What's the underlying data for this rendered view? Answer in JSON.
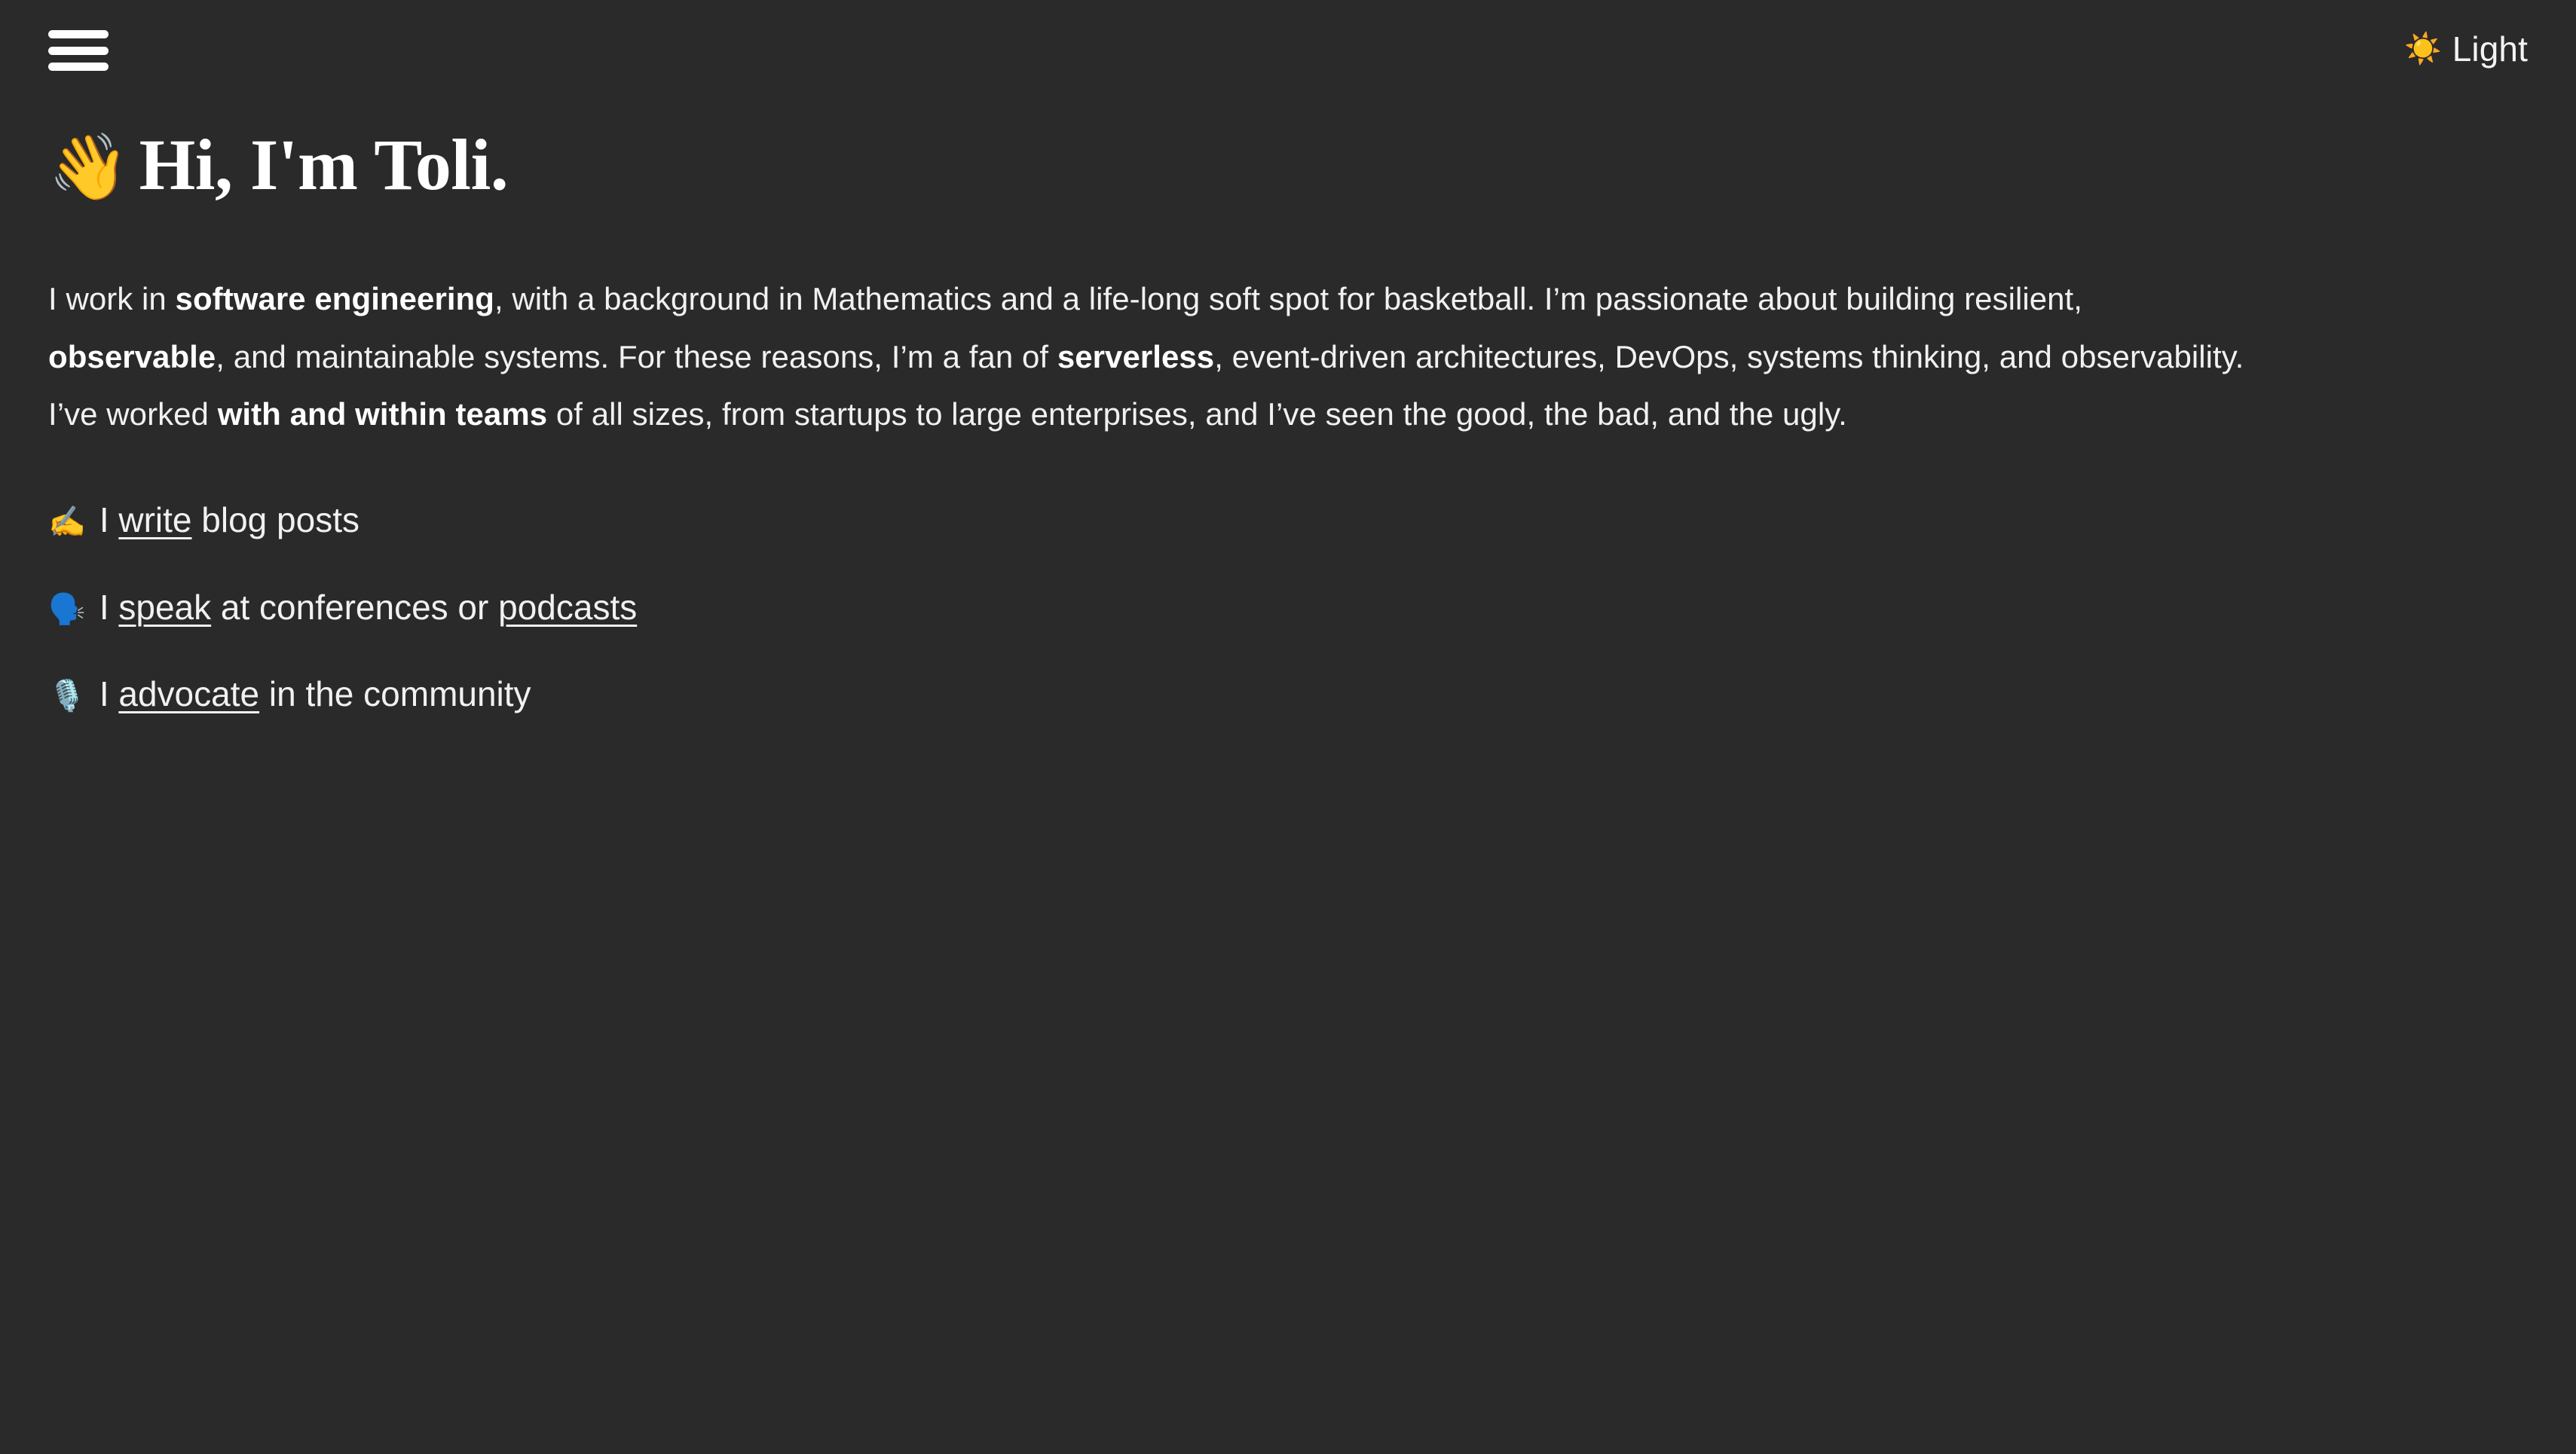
{
  "theme": {
    "background": "#2a2a2a",
    "text_color": "#f1f1f1"
  },
  "topbar": {
    "menu_icon": "hamburger-menu-icon",
    "theme_toggle": {
      "icon": "sun-icon",
      "icon_glyph": "☀️",
      "label": "Light"
    }
  },
  "header": {
    "wave_emoji": "👋",
    "title": "Hi, I'm Toli."
  },
  "intro": {
    "part1": "I work in ",
    "bold1": "software engineering",
    "part2": ", with a background in Mathematics and a life-long soft spot for basketball. I’m passionate about building resilient, ",
    "bold2": "observable",
    "part3": ", and maintainable systems. For these reasons, I’m a fan of ",
    "bold3": "serverless",
    "part4": ", event-driven architectures, DevOps, systems thinking, and observability. I’ve worked ",
    "bold4": "with and within teams",
    "part5": " of all sizes, from startups to large enterprises, and I’ve seen the good, the bad, and the ugly."
  },
  "activities": [
    {
      "emoji": "✍️",
      "icon": "writing-hand-icon",
      "prefix": "I ",
      "link": "write",
      "suffix": " blog posts",
      "link2": "",
      "suffix2": ""
    },
    {
      "emoji": "🗣️",
      "icon": "speaking-head-icon",
      "prefix": "I ",
      "link": "speak",
      "suffix": " at conferences or ",
      "link2": "podcasts",
      "suffix2": ""
    },
    {
      "emoji": "🎙️",
      "icon": "studio-microphone-icon",
      "prefix": "I ",
      "link": "advocate",
      "suffix": " in the community",
      "link2": "",
      "suffix2": ""
    }
  ]
}
